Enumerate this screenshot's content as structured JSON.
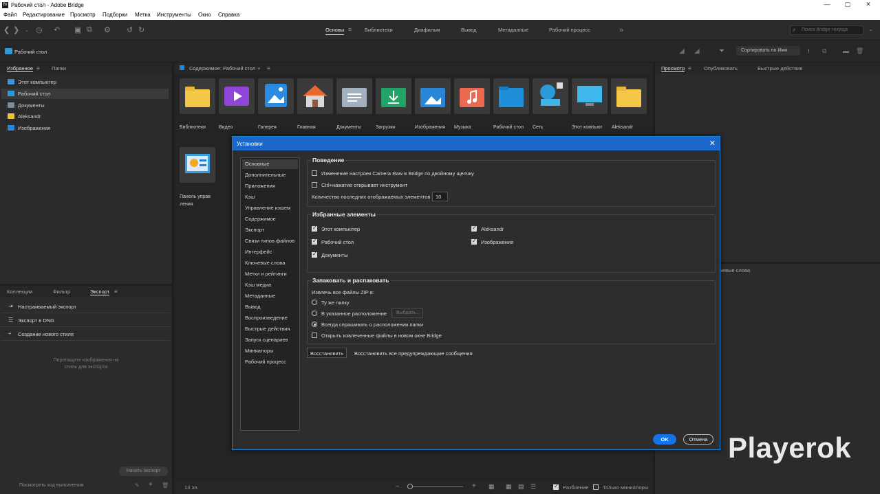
{
  "window": {
    "title": "Рабочий стол - Adobe Bridge",
    "app_icon": "Br"
  },
  "menu": [
    "Файл",
    "Редактирование",
    "Просмотр",
    "Подборки",
    "Метка",
    "Инструменты",
    "Окно",
    "Справка"
  ],
  "workspaces": [
    "Основы",
    "Библиотеки",
    "Диафильм",
    "Вывод",
    "Метаданные",
    "Рабочий процесс"
  ],
  "search_placeholder": "Поиск Bridge текуща",
  "path": "Рабочий стол",
  "sort": "Сортировать по Имя",
  "left_tabs": [
    "Избранное",
    "Папки"
  ],
  "favorites": [
    {
      "label": "Этот компьютер",
      "icon": "computer-icon",
      "color": "#3d8fd6"
    },
    {
      "label": "Рабочий стол",
      "icon": "desktop-icon",
      "color": "#2a9ad8"
    },
    {
      "label": "Документы",
      "icon": "documents-icon",
      "color": "#7b8a9a"
    },
    {
      "label": "Aleksandr",
      "icon": "folder-icon",
      "color": "#f2c03c"
    },
    {
      "label": "Изображения",
      "icon": "pictures-icon",
      "color": "#2a86d8"
    }
  ],
  "content_header": "Содержимое: Рабочий стол",
  "thumbnails": [
    "Библиотеки",
    "Видео",
    "Галерея",
    "Главная",
    "Документы",
    "Загрузки",
    "Изображения",
    "Музыка",
    "Рабочий стол",
    "Сеть",
    "Этот компьют ер",
    "Aleksandr",
    "Панель управ ления"
  ],
  "right_tabs": [
    "Просмотр",
    "Опубликовать",
    "Быстрые действия"
  ],
  "right_keywords_fragment": "чевые слова",
  "bottom_tabs": [
    "Коллекции",
    "Фильтр",
    "Экспорт"
  ],
  "export_items": [
    "Настраиваемый экспорт",
    "Экспорт в DNG",
    "Создание нового стиля"
  ],
  "export_hint": "Перетащите изображения на стиль для экспорта",
  "export_start": "Начать экспорт",
  "export_progress": "Посмотреть ход выполнения",
  "item_count": "13 эл.",
  "status_options": [
    "Разбиение",
    "Только миниатюры"
  ],
  "dialog": {
    "title": "Установки",
    "nav": [
      "Основные",
      "Дополнительные",
      "Приложения",
      "Кэш",
      "Управление кэшем",
      "Содержимое",
      "Экспорт",
      "Связи типов файлов",
      "Интерфейс",
      "Ключевые слова",
      "Метки и рейтинги",
      "Кэш медиа",
      "Метаданные",
      "Вывод",
      "Воспроизведение",
      "Быстрые действия",
      "Запуск сценариев",
      "Миниатюры",
      "Рабочий процесс"
    ],
    "behavior_title": "Поведение",
    "behavior": [
      "Изменение настроек Camera Raw в Bridge по двойному щелчку",
      "Ctrl+нажатие открывает инструмент"
    ],
    "recent_label": "Количество последних отображаемых элементов",
    "recent_value": "10",
    "favorites_title": "Избранные элементы",
    "fav_col1": [
      "Этот компьютер",
      "Рабочий стол",
      "Документы"
    ],
    "fav_col2": [
      "Aleksandr",
      "Изображения"
    ],
    "zip_title": "Запаковать и распаковать",
    "zip_label": "Извлечь все файлы ZIP в:",
    "zip_opts": [
      "Ту же папку",
      "В указанное расположение",
      "Всегда спрашивать о расположении папки"
    ],
    "zip_choose": "Выбрать...",
    "zip_open": "Открыть извлеченные файлы в новом окне Bridge",
    "reset_btn": "Восстановить",
    "reset_label": "Восстановить все предупреждающие сообщения",
    "ok": "OK",
    "cancel": "Отмена"
  },
  "watermark": "Playerok"
}
